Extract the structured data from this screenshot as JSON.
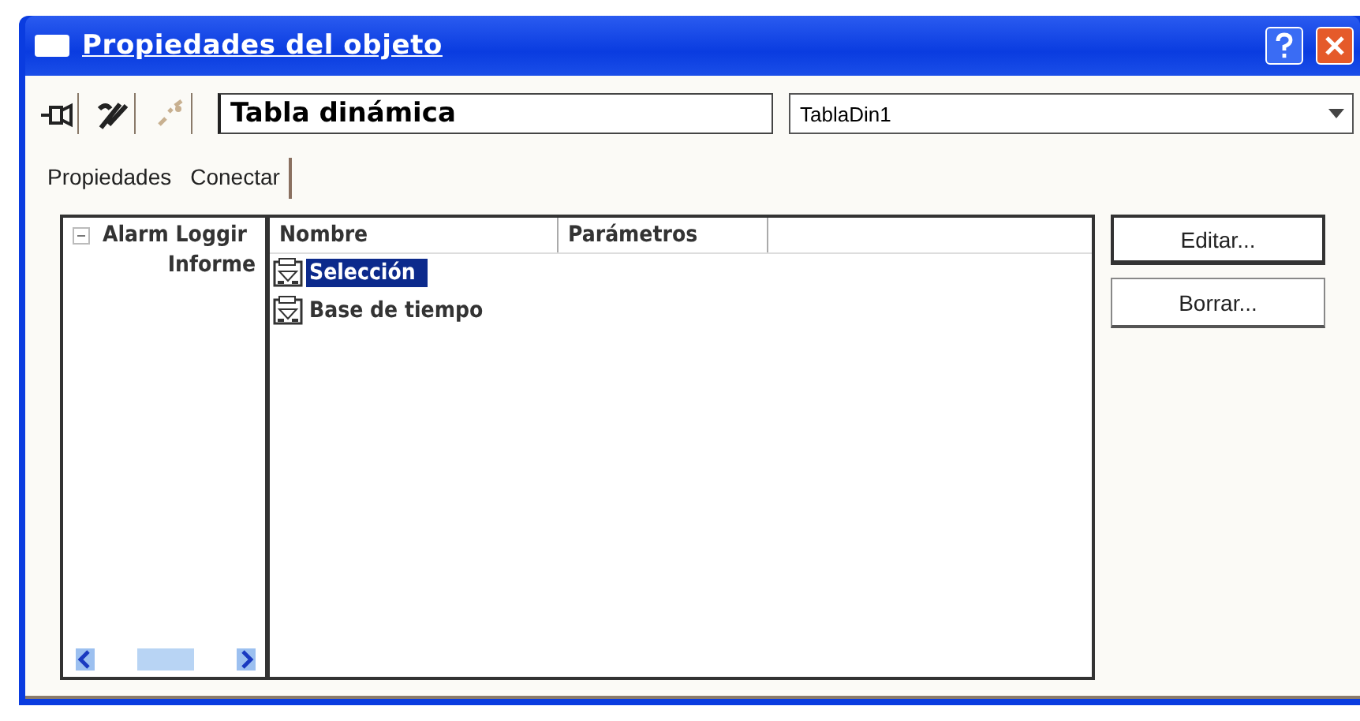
{
  "window": {
    "title": "Propiedades del objeto"
  },
  "toolbar": {
    "object_type": "Tabla dinámica",
    "object_name": "TablaDin1"
  },
  "tabs": [
    {
      "label": "Propiedades",
      "selected": false
    },
    {
      "label": "Conectar",
      "selected": true
    }
  ],
  "tree": [
    {
      "label": "Alarm Loggir",
      "expanded": true,
      "children": [
        {
          "label": "Informe"
        }
      ]
    }
  ],
  "list": {
    "columns": [
      "Nombre",
      "Parámetros"
    ],
    "rows": [
      {
        "name": "Selección",
        "selected": true
      },
      {
        "name": "Base de tiempo",
        "selected": false
      }
    ]
  },
  "buttons": [
    "Editar...",
    "Borrar..."
  ]
}
